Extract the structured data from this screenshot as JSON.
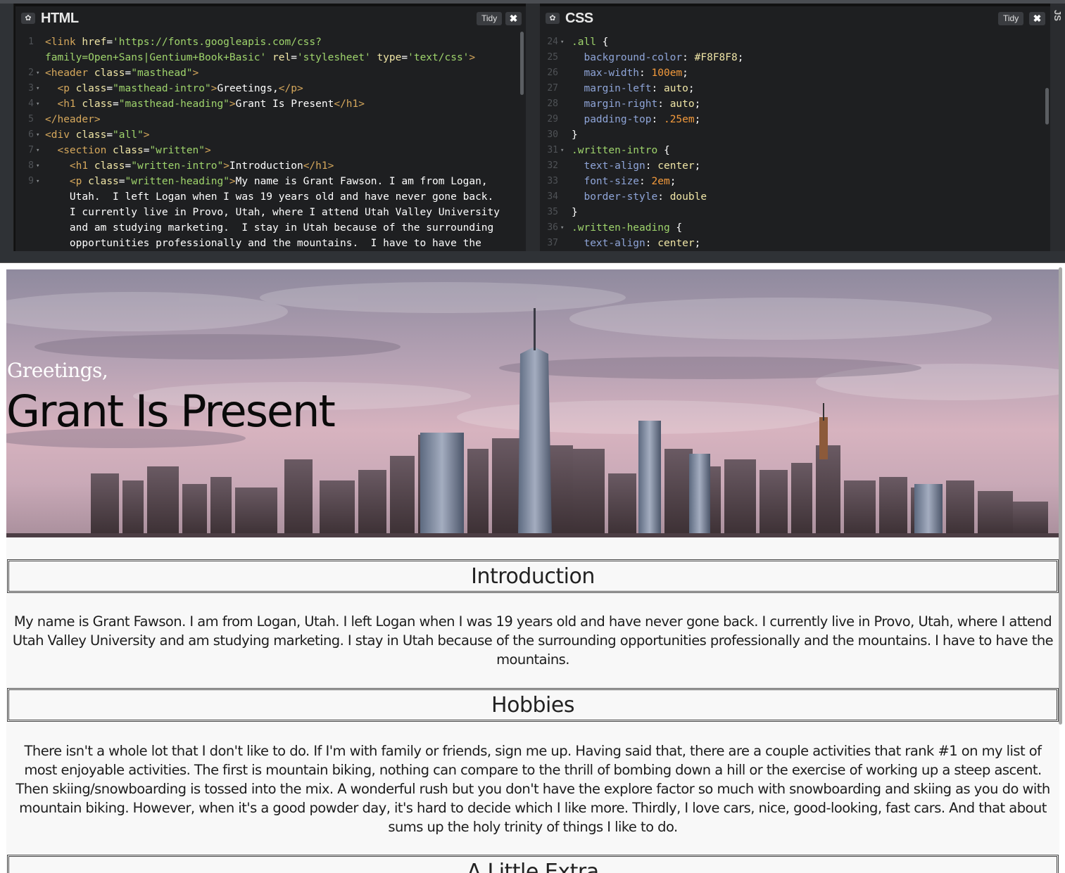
{
  "editors": {
    "html": {
      "title": "HTML",
      "tidy_label": "Tidy",
      "close_label": "✖",
      "lines": [
        {
          "n": "1",
          "fold": "",
          "segs": [
            [
              "t-tag",
              "<link "
            ],
            [
              "t-attr",
              "href"
            ],
            [
              "t-plain",
              "="
            ],
            [
              "t-str",
              "'https://fonts.googleapis.com/css?"
            ]
          ]
        },
        {
          "n": "",
          "fold": "",
          "segs": [
            [
              "t-str",
              "family=Open+Sans|Gentium+Book+Basic'"
            ],
            [
              "t-plain",
              " "
            ],
            [
              "t-attr",
              "rel"
            ],
            [
              "t-plain",
              "="
            ],
            [
              "t-str",
              "'stylesheet'"
            ],
            [
              "t-plain",
              " "
            ],
            [
              "t-attr",
              "type"
            ],
            [
              "t-plain",
              "="
            ],
            [
              "t-str",
              "'text/css'"
            ],
            [
              "t-tag",
              ">"
            ]
          ]
        },
        {
          "n": "2",
          "fold": "▾",
          "segs": [
            [
              "t-tag",
              "<header "
            ],
            [
              "t-attr",
              "class"
            ],
            [
              "t-plain",
              "="
            ],
            [
              "t-str",
              "\"masthead\""
            ],
            [
              "t-tag",
              ">"
            ]
          ]
        },
        {
          "n": "3",
          "fold": "▾",
          "segs": [
            [
              "t-plain",
              "  "
            ],
            [
              "t-tag",
              "<p "
            ],
            [
              "t-attr",
              "class"
            ],
            [
              "t-plain",
              "="
            ],
            [
              "t-str",
              "\"masthead-intro\""
            ],
            [
              "t-tag",
              ">"
            ],
            [
              "t-plain",
              "Greetings,"
            ],
            [
              "t-tag",
              "</p>"
            ]
          ]
        },
        {
          "n": "4",
          "fold": "▾",
          "segs": [
            [
              "t-plain",
              "  "
            ],
            [
              "t-tag",
              "<h1 "
            ],
            [
              "t-attr",
              "class"
            ],
            [
              "t-plain",
              "="
            ],
            [
              "t-str",
              "\"masthead-heading\""
            ],
            [
              "t-tag",
              ">"
            ],
            [
              "t-plain",
              "Grant Is Present"
            ],
            [
              "t-tag",
              "</h1>"
            ]
          ]
        },
        {
          "n": "5",
          "fold": "",
          "segs": [
            [
              "t-tag",
              "</header>"
            ]
          ]
        },
        {
          "n": "6",
          "fold": "▾",
          "segs": [
            [
              "t-tag",
              "<div "
            ],
            [
              "t-attr",
              "class"
            ],
            [
              "t-plain",
              "="
            ],
            [
              "t-str",
              "\"all\""
            ],
            [
              "t-tag",
              ">"
            ]
          ]
        },
        {
          "n": "7",
          "fold": "▾",
          "segs": [
            [
              "t-plain",
              "  "
            ],
            [
              "t-tag",
              "<section "
            ],
            [
              "t-attr",
              "class"
            ],
            [
              "t-plain",
              "="
            ],
            [
              "t-str",
              "\"written\""
            ],
            [
              "t-tag",
              ">"
            ]
          ]
        },
        {
          "n": "8",
          "fold": "▾",
          "segs": [
            [
              "t-plain",
              "    "
            ],
            [
              "t-tag",
              "<h1 "
            ],
            [
              "t-attr",
              "class"
            ],
            [
              "t-plain",
              "="
            ],
            [
              "t-str",
              "\"written-intro\""
            ],
            [
              "t-tag",
              ">"
            ],
            [
              "t-plain",
              "Introduction"
            ],
            [
              "t-tag",
              "</h1>"
            ]
          ]
        },
        {
          "n": "9",
          "fold": "▾",
          "segs": [
            [
              "t-plain",
              "    "
            ],
            [
              "t-tag",
              "<p "
            ],
            [
              "t-attr",
              "class"
            ],
            [
              "t-plain",
              "="
            ],
            [
              "t-str",
              "\"written-heading\""
            ],
            [
              "t-tag",
              ">"
            ],
            [
              "t-plain",
              "My name is Grant Fawson. I am from Logan,"
            ]
          ]
        },
        {
          "n": "",
          "fold": "",
          "segs": [
            [
              "t-plain",
              "    Utah.  I left Logan when I was 19 years old and have never gone back."
            ]
          ]
        },
        {
          "n": "",
          "fold": "",
          "segs": [
            [
              "t-plain",
              "    I currently live in Provo, Utah, where I attend Utah Valley University"
            ]
          ]
        },
        {
          "n": "",
          "fold": "",
          "segs": [
            [
              "t-plain",
              "    and am studying marketing.  I stay in Utah because of the surrounding"
            ]
          ]
        },
        {
          "n": "",
          "fold": "",
          "segs": [
            [
              "t-plain",
              "    opportunities professionally and the mountains.  I have to have the"
            ]
          ]
        }
      ]
    },
    "css": {
      "title": "CSS",
      "tidy_label": "Tidy",
      "close_label": "✖",
      "side_label": "JS",
      "lines": [
        {
          "n": "24",
          "fold": "▾",
          "segs": [
            [
              "t-sel",
              ".all"
            ],
            [
              "t-plain",
              " {"
            ]
          ]
        },
        {
          "n": "25",
          "fold": "",
          "segs": [
            [
              "t-plain",
              "  "
            ],
            [
              "t-prop",
              "background-color"
            ],
            [
              "t-plain",
              ": "
            ],
            [
              "t-val",
              "#F8F8F8"
            ],
            [
              "t-plain",
              ";"
            ]
          ]
        },
        {
          "n": "26",
          "fold": "",
          "segs": [
            [
              "t-plain",
              "  "
            ],
            [
              "t-prop",
              "max-width"
            ],
            [
              "t-plain",
              ": "
            ],
            [
              "t-num",
              "100em"
            ],
            [
              "t-plain",
              ";"
            ]
          ]
        },
        {
          "n": "27",
          "fold": "",
          "segs": [
            [
              "t-plain",
              "  "
            ],
            [
              "t-prop",
              "margin-left"
            ],
            [
              "t-plain",
              ": "
            ],
            [
              "t-val",
              "auto"
            ],
            [
              "t-plain",
              ";"
            ]
          ]
        },
        {
          "n": "28",
          "fold": "",
          "segs": [
            [
              "t-plain",
              "  "
            ],
            [
              "t-prop",
              "margin-right"
            ],
            [
              "t-plain",
              ": "
            ],
            [
              "t-val",
              "auto"
            ],
            [
              "t-plain",
              ";"
            ]
          ]
        },
        {
          "n": "29",
          "fold": "",
          "segs": [
            [
              "t-plain",
              "  "
            ],
            [
              "t-prop",
              "padding-top"
            ],
            [
              "t-plain",
              ": "
            ],
            [
              "t-num",
              ".25em"
            ],
            [
              "t-plain",
              ";"
            ]
          ]
        },
        {
          "n": "30",
          "fold": "",
          "segs": [
            [
              "t-plain",
              "}"
            ]
          ]
        },
        {
          "n": "31",
          "fold": "▾",
          "segs": [
            [
              "t-sel",
              ".written-intro"
            ],
            [
              "t-plain",
              " {"
            ]
          ]
        },
        {
          "n": "32",
          "fold": "",
          "segs": [
            [
              "t-plain",
              "  "
            ],
            [
              "t-prop",
              "text-align"
            ],
            [
              "t-plain",
              ": "
            ],
            [
              "t-val",
              "center"
            ],
            [
              "t-plain",
              ";"
            ]
          ]
        },
        {
          "n": "33",
          "fold": "",
          "segs": [
            [
              "t-plain",
              "  "
            ],
            [
              "t-prop",
              "font-size"
            ],
            [
              "t-plain",
              ": "
            ],
            [
              "t-num",
              "2em"
            ],
            [
              "t-plain",
              ";"
            ]
          ]
        },
        {
          "n": "34",
          "fold": "",
          "segs": [
            [
              "t-plain",
              "  "
            ],
            [
              "t-prop",
              "border-style"
            ],
            [
              "t-plain",
              ": "
            ],
            [
              "t-val",
              "double"
            ]
          ]
        },
        {
          "n": "35",
          "fold": "",
          "segs": [
            [
              "t-plain",
              "}"
            ]
          ]
        },
        {
          "n": "36",
          "fold": "▾",
          "segs": [
            [
              "t-sel",
              ".written-heading"
            ],
            [
              "t-plain",
              " {"
            ]
          ]
        },
        {
          "n": "37",
          "fold": "",
          "segs": [
            [
              "t-plain",
              "  "
            ],
            [
              "t-prop",
              "text-align"
            ],
            [
              "t-plain",
              ": "
            ],
            [
              "t-val",
              "center"
            ],
            [
              "t-plain",
              ";"
            ]
          ]
        }
      ]
    }
  },
  "preview": {
    "masthead_intro": "Greetings,",
    "masthead_heading": "Grant Is Present",
    "sections": [
      {
        "heading": "Introduction",
        "body": "My name is Grant Fawson. I am from Logan, Utah. I left Logan when I was 19 years old and have never gone back. I currently live in Provo, Utah, where I attend Utah Valley University and am studying marketing. I stay in Utah because of the surrounding opportunities professionally and the mountains. I have to have the mountains."
      },
      {
        "heading": "Hobbies",
        "body": "There isn't a whole lot that I don't like to do. If I'm with family or friends, sign me up. Having said that, there are a couple activities that rank #1 on my list of most enjoyable activities. The first is mountain biking, nothing can compare to the thrill of bombing down a hill or the exercise of working up a steep ascent. Then skiing/snowboarding is tossed into the mix. A wonderful rush but you don't have the explore factor so much with snowboarding and skiing as you do with mountain biking. However, when it's a good powder day, it's hard to decide which I like more. Thirdly, I love cars, nice, good-looking, fast cars. And that about sums up the holy trinity of things I like to do."
      },
      {
        "heading": "A Little Extra",
        "body": ""
      }
    ]
  }
}
